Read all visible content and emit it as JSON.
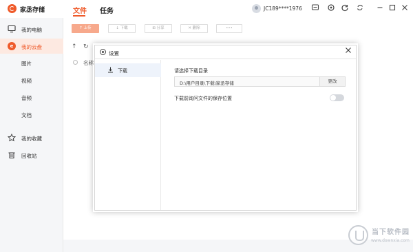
{
  "app": {
    "title": "家丞存储"
  },
  "nav": {
    "tabs": [
      {
        "label": "文件"
      },
      {
        "label": "任务"
      }
    ]
  },
  "user": {
    "name": "JC189****1976"
  },
  "window_icons": {
    "message": "message-icon",
    "settings": "gear-icon",
    "sync": "sync-icon",
    "refresh": "refresh-icon",
    "minimize": "minimize-icon",
    "maximize": "maximize-icon",
    "close": "close-icon"
  },
  "sidebar": {
    "items": [
      {
        "label": "我的电脑",
        "icon": "monitor-icon"
      },
      {
        "label": "我的云盘",
        "icon": "cloud-drive-icon"
      },
      {
        "label": "我的收藏",
        "icon": "star-icon"
      },
      {
        "label": "回收站",
        "icon": "trash-icon"
      }
    ],
    "subitems": [
      {
        "label": "图片"
      },
      {
        "label": "视频"
      },
      {
        "label": "音频"
      },
      {
        "label": "文档"
      }
    ]
  },
  "toolbar": {
    "upload": "上传",
    "download": "下载",
    "share": "分享",
    "delete": "删除",
    "more": "•••"
  },
  "breadcrumb": {
    "up": "↑",
    "refresh": "↻"
  },
  "file_list": {
    "column_name": "名称"
  },
  "settings_dialog": {
    "title": "设置",
    "side_items": [
      {
        "label": "下载"
      }
    ],
    "dir_label": "请选择下载目录",
    "dir_path": "D:\\用户目录\\下载\\家丞存储",
    "change_button": "更改",
    "ask_label": "下载前询问文件的保存位置",
    "ask_enabled": false
  },
  "watermark": {
    "title": "当下软件园",
    "url": "www.downxia.com"
  },
  "colors": {
    "accent": "#ef5a2a",
    "upload_btn": "#f7a98c",
    "active_bg": "#fde9e1"
  }
}
